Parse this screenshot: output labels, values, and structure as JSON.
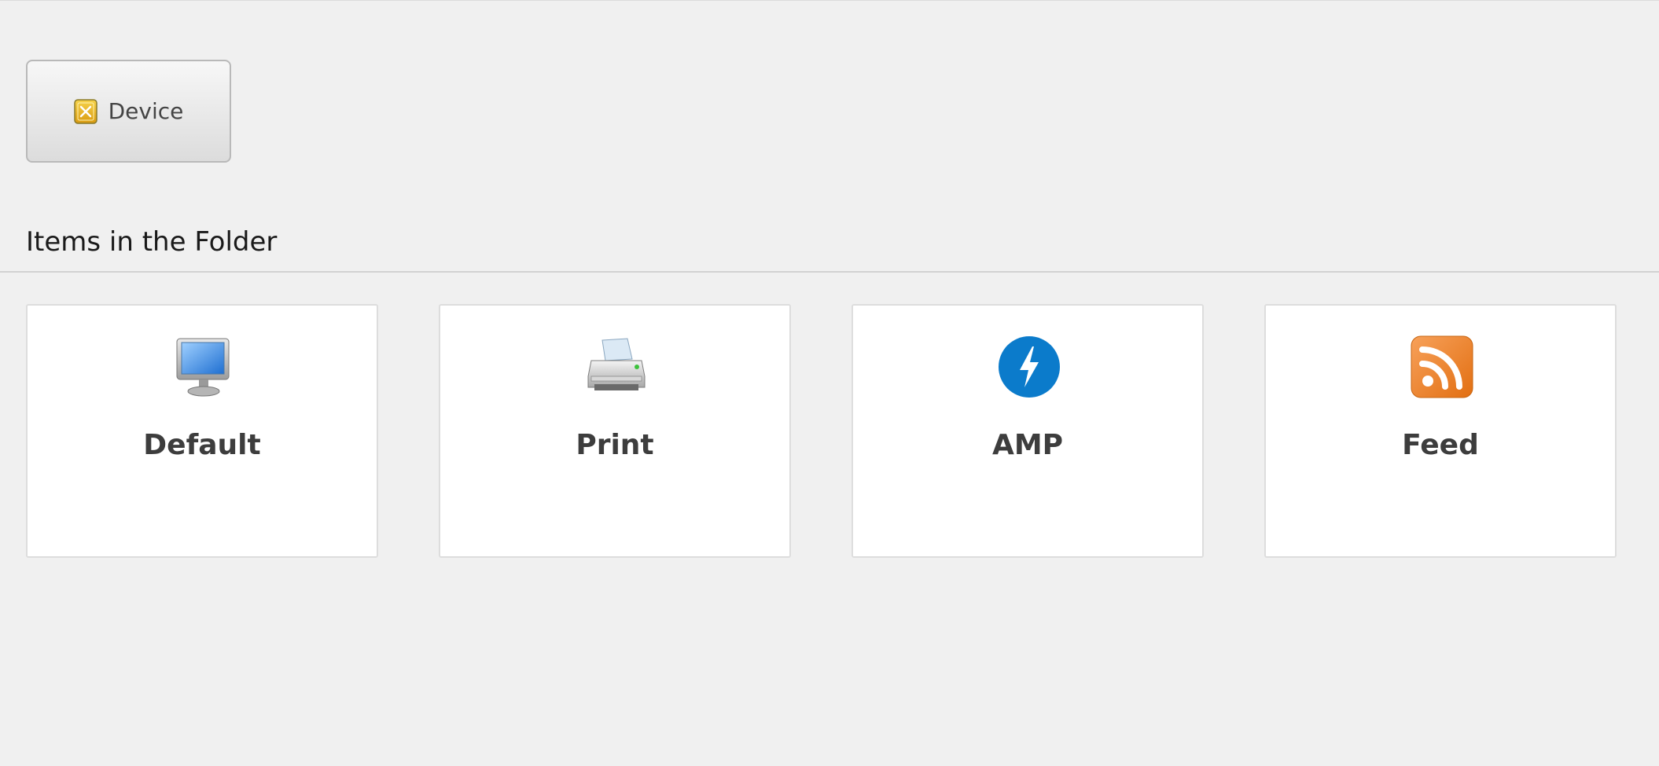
{
  "toolbar": {
    "device_button": {
      "label": "Device",
      "icon": "device-icon"
    }
  },
  "section": {
    "title": "Items in the Folder"
  },
  "items": [
    {
      "label": "Default",
      "icon": "monitor-icon"
    },
    {
      "label": "Print",
      "icon": "printer-icon"
    },
    {
      "label": "AMP",
      "icon": "amp-lightning-icon",
      "color": "#0b7bcb"
    },
    {
      "label": "Feed",
      "icon": "rss-feed-icon",
      "color": "#f28a2e"
    }
  ]
}
